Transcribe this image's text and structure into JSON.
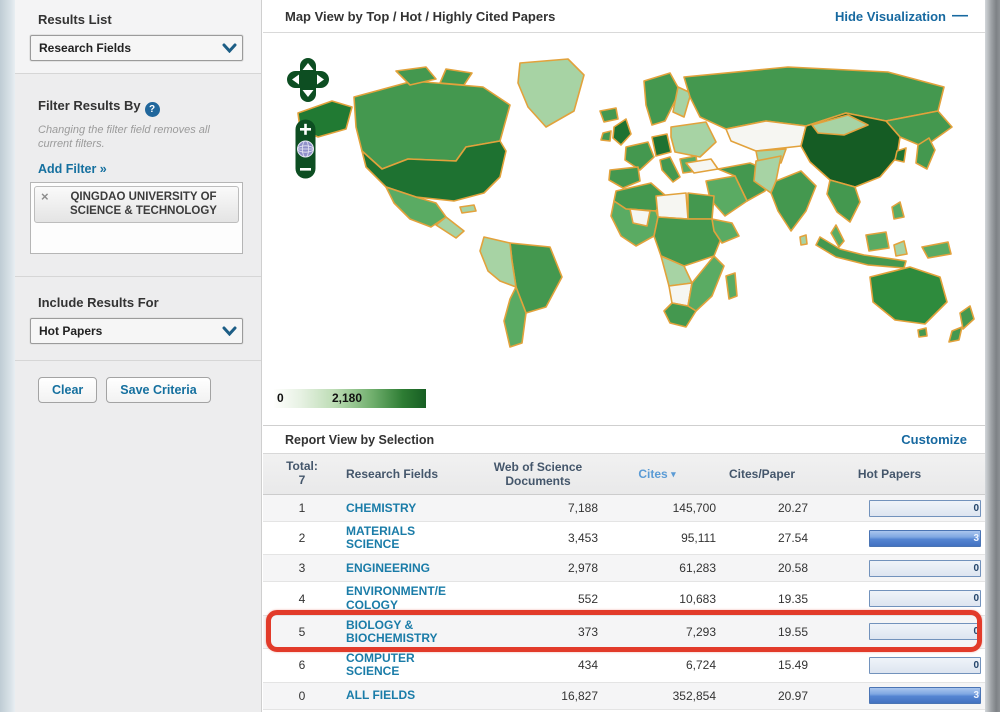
{
  "sidebar": {
    "results_list_label": "Results List",
    "results_dropdown_value": "Research Fields",
    "filter_heading": "Filter Results By",
    "help_icon": "?",
    "filter_note": "Changing the filter field removes all current filters.",
    "add_filter_label": "Add Filter »",
    "filter_tag": {
      "remove_icon": "×",
      "label": "QINGDAO UNIVERSITY OF SCIENCE & TECHNOLOGY"
    },
    "include_heading": "Include Results For",
    "include_dropdown_value": "Hot Papers",
    "clear_button": "Clear",
    "save_button": "Save Criteria"
  },
  "map_panel": {
    "title": "Map View by Top / Hot / Highly Cited Papers",
    "hide_link": "Hide Visualization",
    "hide_icon": "—",
    "controls": {
      "zoom_in": "+",
      "zoom_out": "−",
      "globe_icon": "globe",
      "pan_icon": "pan-arrows"
    },
    "legend": {
      "min": "0",
      "max": "2,180"
    }
  },
  "report": {
    "title": "Report View by Selection",
    "customize_link": "Customize",
    "headers": {
      "total_label": "Total:",
      "total_count": "7",
      "fields": "Research Fields",
      "documents": "Web of Science Documents",
      "cites": "Cites",
      "cites_sort_icon": "▾",
      "cites_per_paper": "Cites/Paper",
      "hot_papers": "Hot Papers"
    },
    "rows": [
      {
        "rank": "1",
        "field": "CHEMISTRY",
        "docs": "7,188",
        "cites": "145,700",
        "cites_per_paper": "20.27",
        "hot_papers": 0,
        "highlighted": false
      },
      {
        "rank": "2",
        "field": "MATERIALS SCIENCE",
        "docs": "3,453",
        "cites": "95,111",
        "cites_per_paper": "27.54",
        "hot_papers": 3,
        "highlighted": false
      },
      {
        "rank": "3",
        "field": "ENGINEERING",
        "docs": "2,978",
        "cites": "61,283",
        "cites_per_paper": "20.58",
        "hot_papers": 0,
        "highlighted": false
      },
      {
        "rank": "4",
        "field": "ENVIRONMENT/ECOLOGY",
        "docs": "552",
        "cites": "10,683",
        "cites_per_paper": "19.35",
        "hot_papers": 0,
        "highlighted": false
      },
      {
        "rank": "5",
        "field": "BIOLOGY & BIOCHEMISTRY",
        "docs": "373",
        "cites": "7,293",
        "cites_per_paper": "19.55",
        "hot_papers": 0,
        "highlighted": true
      },
      {
        "rank": "6",
        "field": "COMPUTER SCIENCE",
        "docs": "434",
        "cites": "6,724",
        "cites_per_paper": "15.49",
        "hot_papers": 0,
        "highlighted": false
      },
      {
        "rank": "0",
        "field": "ALL FIELDS",
        "docs": "16,827",
        "cites": "352,854",
        "cites_per_paper": "20.97",
        "hot_papers": 3,
        "highlighted": false
      }
    ]
  },
  "colors": {
    "link_blue": "#1769a0",
    "field_link_blue": "#1a7ca8",
    "highlight_red": "#e23b2a",
    "map_border_orange": "#e2a23c",
    "map_green_dark": "#155c24",
    "map_green_mid": "#44984f",
    "map_green_light": "#a7d3a4",
    "bar_fill_blue": "#4372c1"
  }
}
